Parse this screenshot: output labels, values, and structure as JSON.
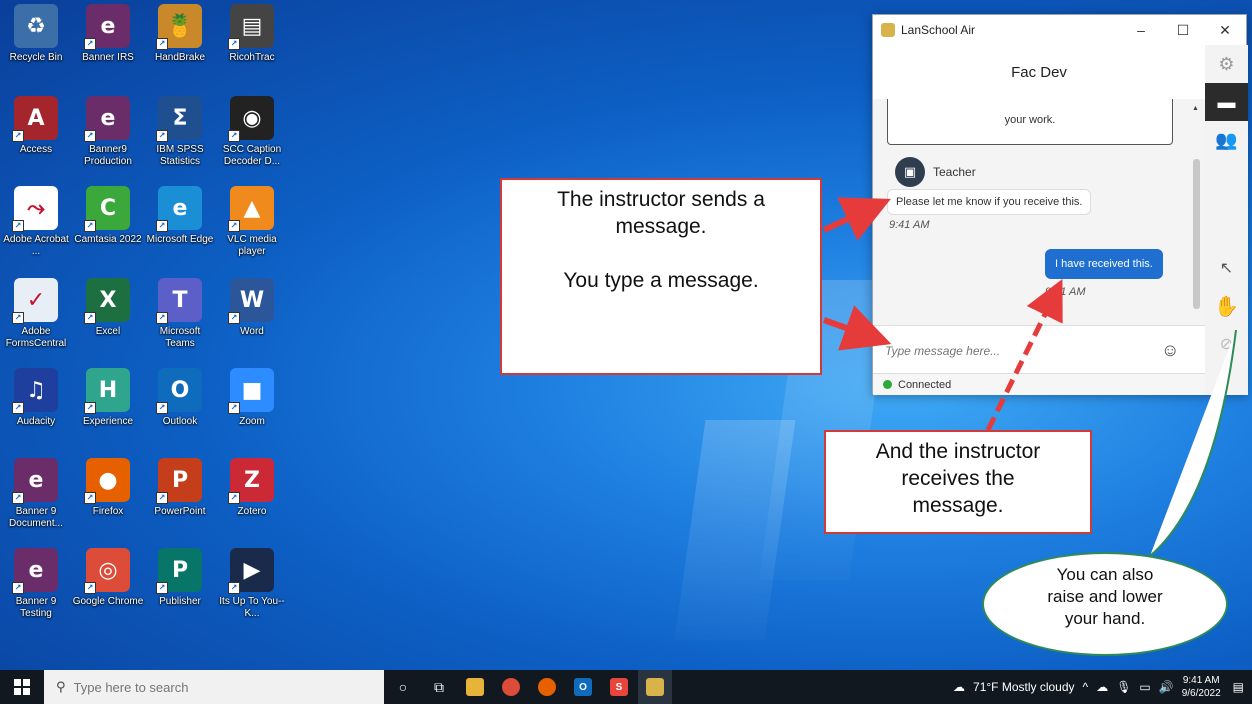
{
  "desktop": {
    "icons": [
      {
        "label": "Recycle Bin",
        "icon": "recycle-bin-icon",
        "color": "#3c6fa8",
        "glyph": "♻"
      },
      {
        "label": "Banner IRS",
        "icon": "banner-irs-icon",
        "color": "#6b2c6a",
        "glyph": "e"
      },
      {
        "label": "HandBrake",
        "icon": "handbrake-icon",
        "color": "#c9892b",
        "glyph": "🍍"
      },
      {
        "label": "RicohTrac",
        "icon": "ricohtrac-icon",
        "color": "#444444",
        "glyph": "▤"
      },
      {
        "label": "Access",
        "icon": "access-icon",
        "color": "#a4262c",
        "glyph": "A"
      },
      {
        "label": "Banner9 Production",
        "icon": "banner9-production-icon",
        "color": "#6b2c6a",
        "glyph": "e"
      },
      {
        "label": "IBM SPSS Statistics",
        "icon": "ibm-spss-icon",
        "color": "#1f4f8f",
        "glyph": "Σ"
      },
      {
        "label": "SCC Caption Decoder D...",
        "icon": "scc-caption-decoder-icon",
        "color": "#222222",
        "glyph": "◉"
      },
      {
        "label": "Adobe Acrobat ...",
        "icon": "adobe-acrobat-icon",
        "color": "#ffffff",
        "glyph": "⤳"
      },
      {
        "label": "Camtasia 2022",
        "icon": "camtasia-icon",
        "color": "#3aa83a",
        "glyph": "C"
      },
      {
        "label": "Microsoft Edge",
        "icon": "microsoft-edge-icon",
        "color": "#1a8fd6",
        "glyph": "e"
      },
      {
        "label": "VLC media player",
        "icon": "vlc-icon",
        "color": "#f08a1c",
        "glyph": "▲"
      },
      {
        "label": "Adobe FormsCentral",
        "icon": "adobe-formscentral-icon",
        "color": "#e8eef5",
        "glyph": "✓"
      },
      {
        "label": "Excel",
        "icon": "excel-icon",
        "color": "#1d6f42",
        "glyph": "X"
      },
      {
        "label": "Microsoft Teams",
        "icon": "microsoft-teams-icon",
        "color": "#5b5fc7",
        "glyph": "T"
      },
      {
        "label": "Word",
        "icon": "word-icon",
        "color": "#2b579a",
        "glyph": "W"
      },
      {
        "label": "Audacity",
        "icon": "audacity-icon",
        "color": "#1f3f9f",
        "glyph": "♫"
      },
      {
        "label": "Experience",
        "icon": "experience-icon",
        "color": "#2fa58e",
        "glyph": "H"
      },
      {
        "label": "Outlook",
        "icon": "outlook-icon",
        "color": "#0f6cbd",
        "glyph": "O"
      },
      {
        "label": "Zoom",
        "icon": "zoom-icon",
        "color": "#2d8cff",
        "glyph": "■"
      },
      {
        "label": "Banner 9 Document...",
        "icon": "banner9-document-icon",
        "color": "#6b2c6a",
        "glyph": "e"
      },
      {
        "label": "Firefox",
        "icon": "firefox-icon",
        "color": "#e66000",
        "glyph": "●"
      },
      {
        "label": "PowerPoint",
        "icon": "powerpoint-icon",
        "color": "#c43e1c",
        "glyph": "P"
      },
      {
        "label": "Zotero",
        "icon": "zotero-icon",
        "color": "#cc2936",
        "glyph": "Z"
      },
      {
        "label": "Banner 9 Testing",
        "icon": "banner9-testing-icon",
        "color": "#6b2c6a",
        "glyph": "e"
      },
      {
        "label": "Google Chrome",
        "icon": "google-chrome-icon",
        "color": "#dd4b39",
        "glyph": "◎"
      },
      {
        "label": "Publisher",
        "icon": "publisher-icon",
        "color": "#077568",
        "glyph": "P"
      },
      {
        "label": "Its Up To You-- K...",
        "icon": "video-file-icon",
        "color": "#1a2a4a",
        "glyph": "▶"
      }
    ]
  },
  "lanschool": {
    "title": "LanSchool Air",
    "window_controls": [
      "–",
      "☐",
      "✕"
    ],
    "class_name": "Fac Dev",
    "notice_text": "your work.",
    "sender_name": "Teacher",
    "incoming_message": "Please let me know if you receive this.",
    "incoming_time": "9:41 AM",
    "outgoing_message": "I have received this.",
    "outgoing_time": "9:41 AM",
    "input_placeholder": "Type message here...",
    "status_text": "Connected",
    "status_color": "#2eaa3c",
    "sidebar_icons": [
      "gear-icon",
      "chat-icon",
      "people-icon",
      "cursor-icon",
      "raise-hand-icon",
      "hand-off-icon"
    ]
  },
  "callouts": {
    "instructor_sends": [
      "The instructor sends a",
      "message."
    ],
    "you_type": "You type a message.",
    "instructor_receives": [
      "And the instructor",
      "receives the",
      "message."
    ],
    "raise_hand": [
      "You can also",
      "raise and lower",
      "your hand."
    ],
    "border_color": "#d23a3a",
    "arrow_color": "#e63b3b",
    "oval_border_color": "#2e8b57"
  },
  "taskbar": {
    "search_placeholder": "Type here to search",
    "weather": "71°F  Mostly cloudy",
    "time": "9:41 AM",
    "date": "9/6/2022",
    "pinned": [
      "cortana-icon",
      "task-view-icon",
      "file-explorer-icon",
      "chrome-icon",
      "firefox-icon",
      "outlook-icon",
      "snagit-icon",
      "lanschool-icon"
    ]
  }
}
